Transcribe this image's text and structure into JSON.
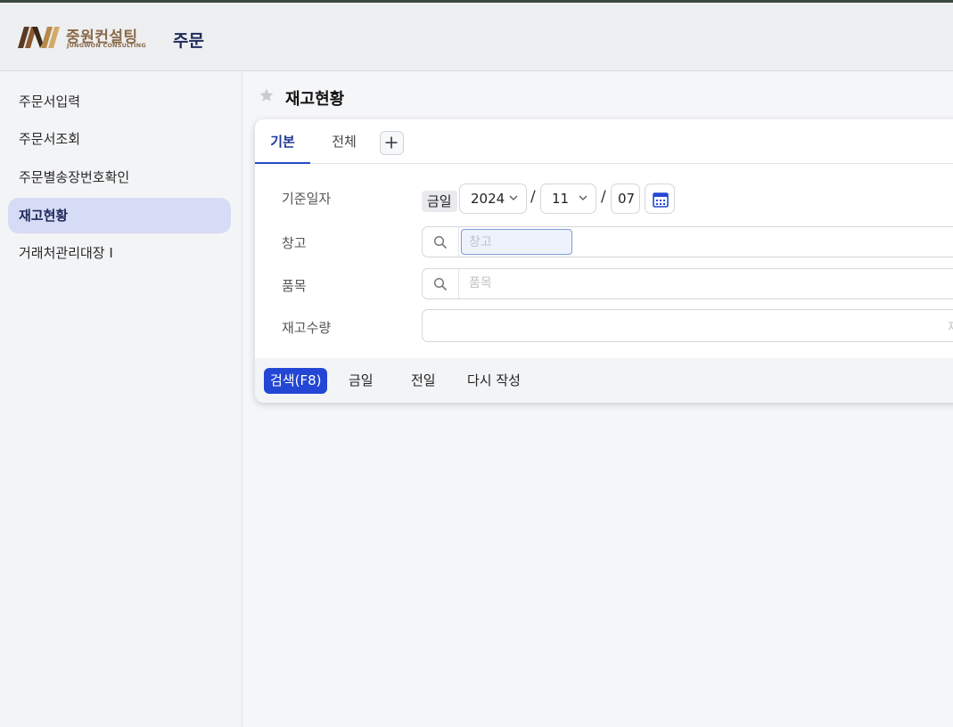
{
  "header": {
    "logo_name": "중원컨설팅",
    "logo_sub": "JUNGWON CONSULTING",
    "app_title": "주문"
  },
  "sidebar": {
    "items": [
      {
        "label": "주문서입력",
        "active": false
      },
      {
        "label": "주문서조회",
        "active": false
      },
      {
        "label": "주문별송장번호확인",
        "active": false
      },
      {
        "label": "재고현황",
        "active": true
      },
      {
        "label": "거래처관리대장 I",
        "active": false
      }
    ]
  },
  "page": {
    "title": "재고현황",
    "star_icon": "star-icon"
  },
  "tabs": {
    "items": [
      "기본",
      "전체"
    ],
    "active": "기본",
    "add_icon": "plus-icon"
  },
  "form": {
    "date_label": "기준일자",
    "today_badge": "금일",
    "year": "2024",
    "month": "11",
    "day": "07",
    "separator": "/",
    "warehouse_label": "창고",
    "warehouse_placeholder": "창고",
    "item_label": "품목",
    "item_placeholder": "품목",
    "qty_label": "재고수량",
    "qty_placeholder": "재"
  },
  "actions": {
    "search": "검색(F8)",
    "today": "금일",
    "prev_day": "전일",
    "reset": "다시 작성"
  },
  "colors": {
    "accent": "#2347d4",
    "active_nav_bg": "#d6dcf6",
    "logo_brown": "#8a6a4a"
  }
}
